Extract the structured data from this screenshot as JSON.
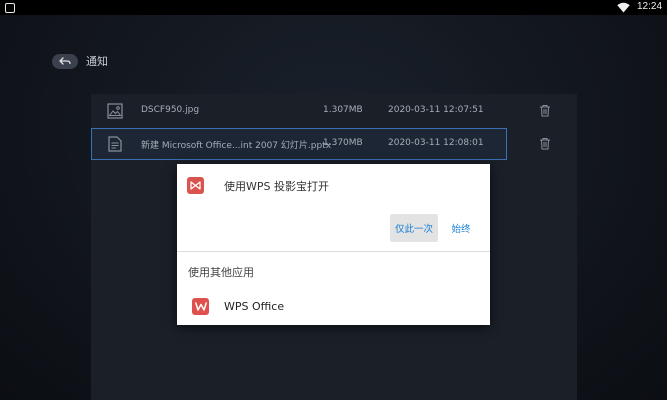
{
  "statusbar": {
    "time": "12:24"
  },
  "header": {
    "title": "通知"
  },
  "files": [
    {
      "name": "DSCF950.jpg",
      "size": "1.307MB",
      "date": "2020-03-11 12:07:51"
    },
    {
      "name": "新建 Microsoft Office...int 2007 幻灯片.pptx",
      "size": "1.370MB",
      "date": "2020-03-11 12:08:01"
    }
  ],
  "dialog": {
    "title": "使用WPS 投影宝打开",
    "once_label": "仅此一次",
    "always_label": "始终",
    "other_apps_label": "使用其他应用",
    "apps": [
      {
        "name": "WPS Office"
      }
    ]
  },
  "colors": {
    "accent": "#1a7fd6",
    "selection": "#3d6fb6",
    "wps_red": "#e0504c"
  }
}
